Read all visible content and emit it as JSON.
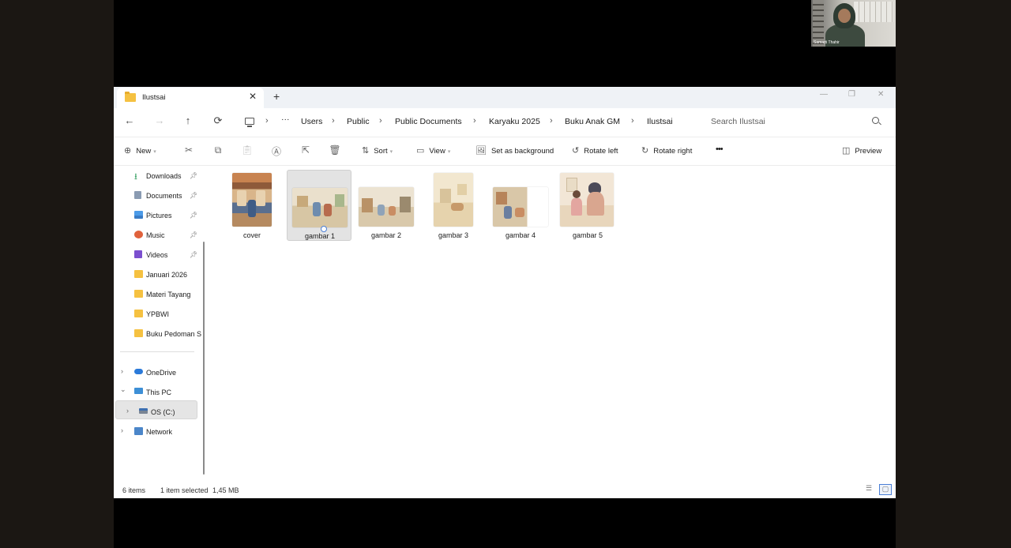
{
  "webcam": {
    "participant_name": "Samarti Thahir"
  },
  "tab": {
    "title": "Ilustsai",
    "close": "✕",
    "new_tab": "+"
  },
  "window_controls": {
    "minimize": "—",
    "maximize": "❐",
    "close": "✕"
  },
  "nav": {
    "back": "←",
    "forward": "→",
    "up": "↑",
    "refresh": "⟳",
    "overflow": "···"
  },
  "breadcrumb": [
    "Users",
    "Public",
    "Public Documents",
    "Karyaku 2025",
    "Buku Anak GM",
    "Ilustsai"
  ],
  "search": {
    "placeholder": "Search Ilustsai"
  },
  "toolbar": {
    "new_label": "New",
    "sort_label": "Sort",
    "view_label": "View",
    "set_background_label": "Set as background",
    "rotate_left_label": "Rotate left",
    "rotate_right_label": "Rotate right",
    "more_label": "•••",
    "preview_label": "Preview"
  },
  "sidebar": {
    "quick_access": [
      {
        "label": "Downloads",
        "icon": "download-icon",
        "pinned": true
      },
      {
        "label": "Documents",
        "icon": "document-icon",
        "pinned": true
      },
      {
        "label": "Pictures",
        "icon": "picture-icon",
        "pinned": true
      },
      {
        "label": "Music",
        "icon": "music-icon",
        "pinned": true
      },
      {
        "label": "Videos",
        "icon": "video-icon",
        "pinned": true
      },
      {
        "label": "Januari 2026",
        "icon": "folder-icon",
        "pinned": false
      },
      {
        "label": "Materi Tayang",
        "icon": "folder-icon",
        "pinned": false
      },
      {
        "label": "YPBWI",
        "icon": "folder-icon",
        "pinned": false
      },
      {
        "label": "Buku Pedoman S",
        "icon": "folder-icon",
        "pinned": false
      }
    ],
    "tree": [
      {
        "label": "OneDrive",
        "icon": "cloud-icon",
        "expanded": false
      },
      {
        "label": "This PC",
        "icon": "computer-icon",
        "expanded": true
      },
      {
        "label": "OS (C:)",
        "icon": "drive-icon",
        "expanded": false,
        "selected": true
      },
      {
        "label": "Network",
        "icon": "network-icon",
        "expanded": false
      }
    ]
  },
  "files": [
    {
      "name": "cover",
      "selected": false
    },
    {
      "name": "gambar 1",
      "selected": true
    },
    {
      "name": "gambar 2",
      "selected": false
    },
    {
      "name": "gambar 3",
      "selected": false
    },
    {
      "name": "gambar 4",
      "selected": false
    },
    {
      "name": "gambar 5",
      "selected": false
    }
  ],
  "status": {
    "item_count": "6 items",
    "selection": "1 item selected",
    "size": "1,45 MB"
  },
  "colors": {
    "folder": "#f5c141",
    "accent": "#4a7fd6",
    "selection_bg": "#e3e3e3"
  }
}
